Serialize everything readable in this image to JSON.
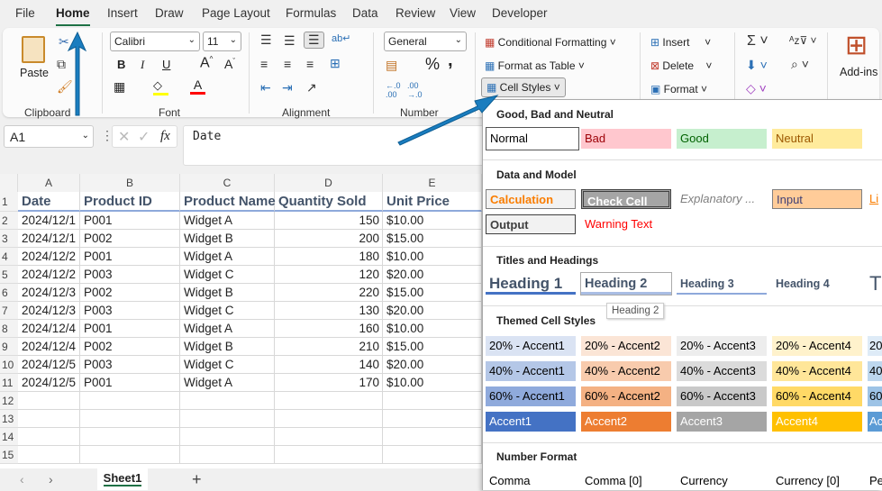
{
  "menu_tabs": [
    "File",
    "Home",
    "Insert",
    "Draw",
    "Page Layout",
    "Formulas",
    "Data",
    "Review",
    "View",
    "Developer"
  ],
  "active_tab": "Home",
  "ribbon": {
    "clipboard": {
      "paste": "Paste",
      "label": "Clipboard"
    },
    "font": {
      "name": "Calibri",
      "size": "11",
      "bold": "B",
      "italic": "I",
      "underline": "U",
      "label": "Font",
      "fill_color": "#ffff00",
      "font_color": "#ff0000"
    },
    "alignment": {
      "label": "Alignment"
    },
    "number": {
      "format": "General",
      "percent": "%",
      "comma": ",",
      "label": "Number"
    },
    "styles": {
      "conditional": "Conditional Formatting",
      "format_table": "Format as Table",
      "cell_styles": "Cell Styles"
    },
    "cells": {
      "insert": "Insert",
      "delete": "Delete",
      "format": "Format"
    },
    "addins": "Add-ins"
  },
  "formula_bar": {
    "name_box": "A1",
    "fx": "fx",
    "value": "Date"
  },
  "columns": [
    "A",
    "B",
    "C",
    "D",
    "E"
  ],
  "header_row": [
    "Date",
    "Product ID",
    "Product Name",
    "Quantity Sold",
    "Unit Price"
  ],
  "rows": [
    [
      "2024/12/1",
      "P001",
      "Widget A",
      "150",
      "$10.00"
    ],
    [
      "2024/12/1",
      "P002",
      "Widget B",
      "200",
      "$15.00"
    ],
    [
      "2024/12/2",
      "P001",
      "Widget A",
      "180",
      "$10.00"
    ],
    [
      "2024/12/2",
      "P003",
      "Widget C",
      "120",
      "$20.00"
    ],
    [
      "2024/12/3",
      "P002",
      "Widget B",
      "220",
      "$15.00"
    ],
    [
      "2024/12/3",
      "P003",
      "Widget C",
      "130",
      "$20.00"
    ],
    [
      "2024/12/4",
      "P001",
      "Widget A",
      "160",
      "$10.00"
    ],
    [
      "2024/12/4",
      "P002",
      "Widget B",
      "210",
      "$15.00"
    ],
    [
      "2024/12/5",
      "P003",
      "Widget C",
      "140",
      "$20.00"
    ],
    [
      "2024/12/5",
      "P001",
      "Widget A",
      "170",
      "$10.00"
    ]
  ],
  "row_numbers": [
    "1",
    "2",
    "3",
    "4",
    "5",
    "6",
    "7",
    "8",
    "9",
    "10",
    "11",
    "12",
    "13",
    "14",
    "15"
  ],
  "sheet_tabs": {
    "active": "Sheet1",
    "add": "+"
  },
  "cell_styles": {
    "sections": {
      "good_bad": "Good, Bad and Neutral",
      "data_model": "Data and Model",
      "titles": "Titles and Headings",
      "themed": "Themed Cell Styles",
      "number": "Number Format"
    },
    "good_bad": [
      {
        "label": "Normal",
        "bg": "#ffffff",
        "fg": "#000000"
      },
      {
        "label": "Bad",
        "bg": "#ffc7ce",
        "fg": "#9c0006"
      },
      {
        "label": "Good",
        "bg": "#c6efce",
        "fg": "#006100"
      },
      {
        "label": "Neutral",
        "bg": "#ffeb9c",
        "fg": "#9c5700"
      }
    ],
    "data_model": [
      {
        "label": "Calculation",
        "bg": "#f2f2f2",
        "fg": "#fa7d00"
      },
      {
        "label": "Check Cell",
        "bg": "#a5a5a5",
        "fg": "#ffffff"
      },
      {
        "label": "Explanatory ...",
        "bg": "#ffffff",
        "fg": "#7f7f7f"
      },
      {
        "label": "Input",
        "bg": "#ffcc99",
        "fg": "#3f3f76"
      },
      {
        "label": "Li",
        "bg": "#ffffff",
        "fg": "#fa7d00"
      },
      {
        "label": "Output",
        "bg": "#f2f2f2",
        "fg": "#3f3f3f"
      },
      {
        "label": "Warning Text",
        "bg": "#ffffff",
        "fg": "#ff0000"
      }
    ],
    "headings": [
      "Heading 1",
      "Heading 2",
      "Heading 3",
      "Heading 4",
      "T"
    ],
    "tooltip": "Heading 2",
    "themed": [
      [
        {
          "label": "20% - Accent1",
          "bg": "#dae3f3"
        },
        {
          "label": "20% - Accent2",
          "bg": "#fbe5d6"
        },
        {
          "label": "20% - Accent3",
          "bg": "#ededed"
        },
        {
          "label": "20% - Accent4",
          "bg": "#fff2cc"
        },
        {
          "label": "20",
          "bg": "#deebf7"
        }
      ],
      [
        {
          "label": "40% - Accent1",
          "bg": "#b4c7e7"
        },
        {
          "label": "40% - Accent2",
          "bg": "#f8cbad"
        },
        {
          "label": "40% - Accent3",
          "bg": "#dbdbdb"
        },
        {
          "label": "40% - Accent4",
          "bg": "#ffe699"
        },
        {
          "label": "40",
          "bg": "#bdd7ee"
        }
      ],
      [
        {
          "label": "60% - Accent1",
          "bg": "#8faadc"
        },
        {
          "label": "60% - Accent2",
          "bg": "#f4b183"
        },
        {
          "label": "60% - Accent3",
          "bg": "#c9c9c9"
        },
        {
          "label": "60% - Accent4",
          "bg": "#ffd966"
        },
        {
          "label": "60",
          "bg": "#9dc3e6"
        }
      ],
      [
        {
          "label": "Accent1",
          "bg": "#4472c4"
        },
        {
          "label": "Accent2",
          "bg": "#ed7d31"
        },
        {
          "label": "Accent3",
          "bg": "#a5a5a5"
        },
        {
          "label": "Accent4",
          "bg": "#ffc000"
        },
        {
          "label": "Ac",
          "bg": "#5b9bd5"
        }
      ]
    ],
    "number_format": [
      "Comma",
      "Comma [0]",
      "Currency",
      "Currency [0]",
      "Pe"
    ]
  },
  "accent_color": "#1e7145"
}
